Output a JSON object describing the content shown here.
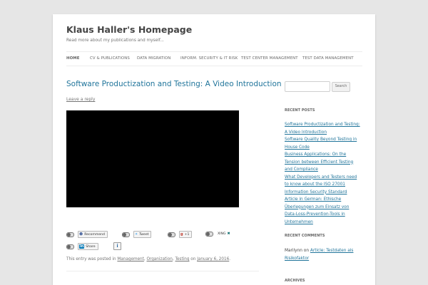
{
  "site": {
    "title": "Klaus Haller's Homepage",
    "description": "Read more about my publications and myself..."
  },
  "nav": {
    "items": [
      "HOME",
      "CV & PUBLICATIONS",
      "DATA MIGRATION",
      "INFORM. SECURITY & IT RISK",
      "TEST CENTER MANAGEMENT",
      "TEST DATA MANAGEMENT"
    ]
  },
  "post": {
    "title": "Software Productization and Testing: A Video Introduction",
    "leave_reply": "Leave a reply",
    "share_buttons": {
      "recommend": "Recommend",
      "tweet": "Tweet",
      "gplus": "+1",
      "xing": "XING",
      "share": "Share"
    },
    "info_icon": "i",
    "meta": {
      "prefix": "This entry was posted in",
      "categories": [
        "Management",
        "Organization",
        "Testing"
      ],
      "on": "on",
      "date": "January 6, 2016"
    }
  },
  "sidebar": {
    "search_button": "Search",
    "recent_posts_title": "RECENT POSTS",
    "recent_posts": [
      "Software Productization and Testing: A Video Introduction",
      "Software Quality Beyond Testing in House Code",
      "Business Applications: On the Tension between Efficient Testing and Compliance",
      "What Developers and Testers need to know about the ISO 27001 Information Security Standard",
      "Article in German: Ethische Überlegungen zum Einsatz von Data-Loss-Prevention-Tools in Unternehmen"
    ],
    "recent_comments_title": "RECENT COMMENTS",
    "recent_comment": {
      "author": "Marilynn",
      "on": "on",
      "link": "Article: Testdaten als Risikofaktor"
    },
    "archives_title": "ARCHIVES"
  },
  "colors": {
    "link": "#21759b",
    "background": "#e6e6e6",
    "page": "#ffffff"
  }
}
